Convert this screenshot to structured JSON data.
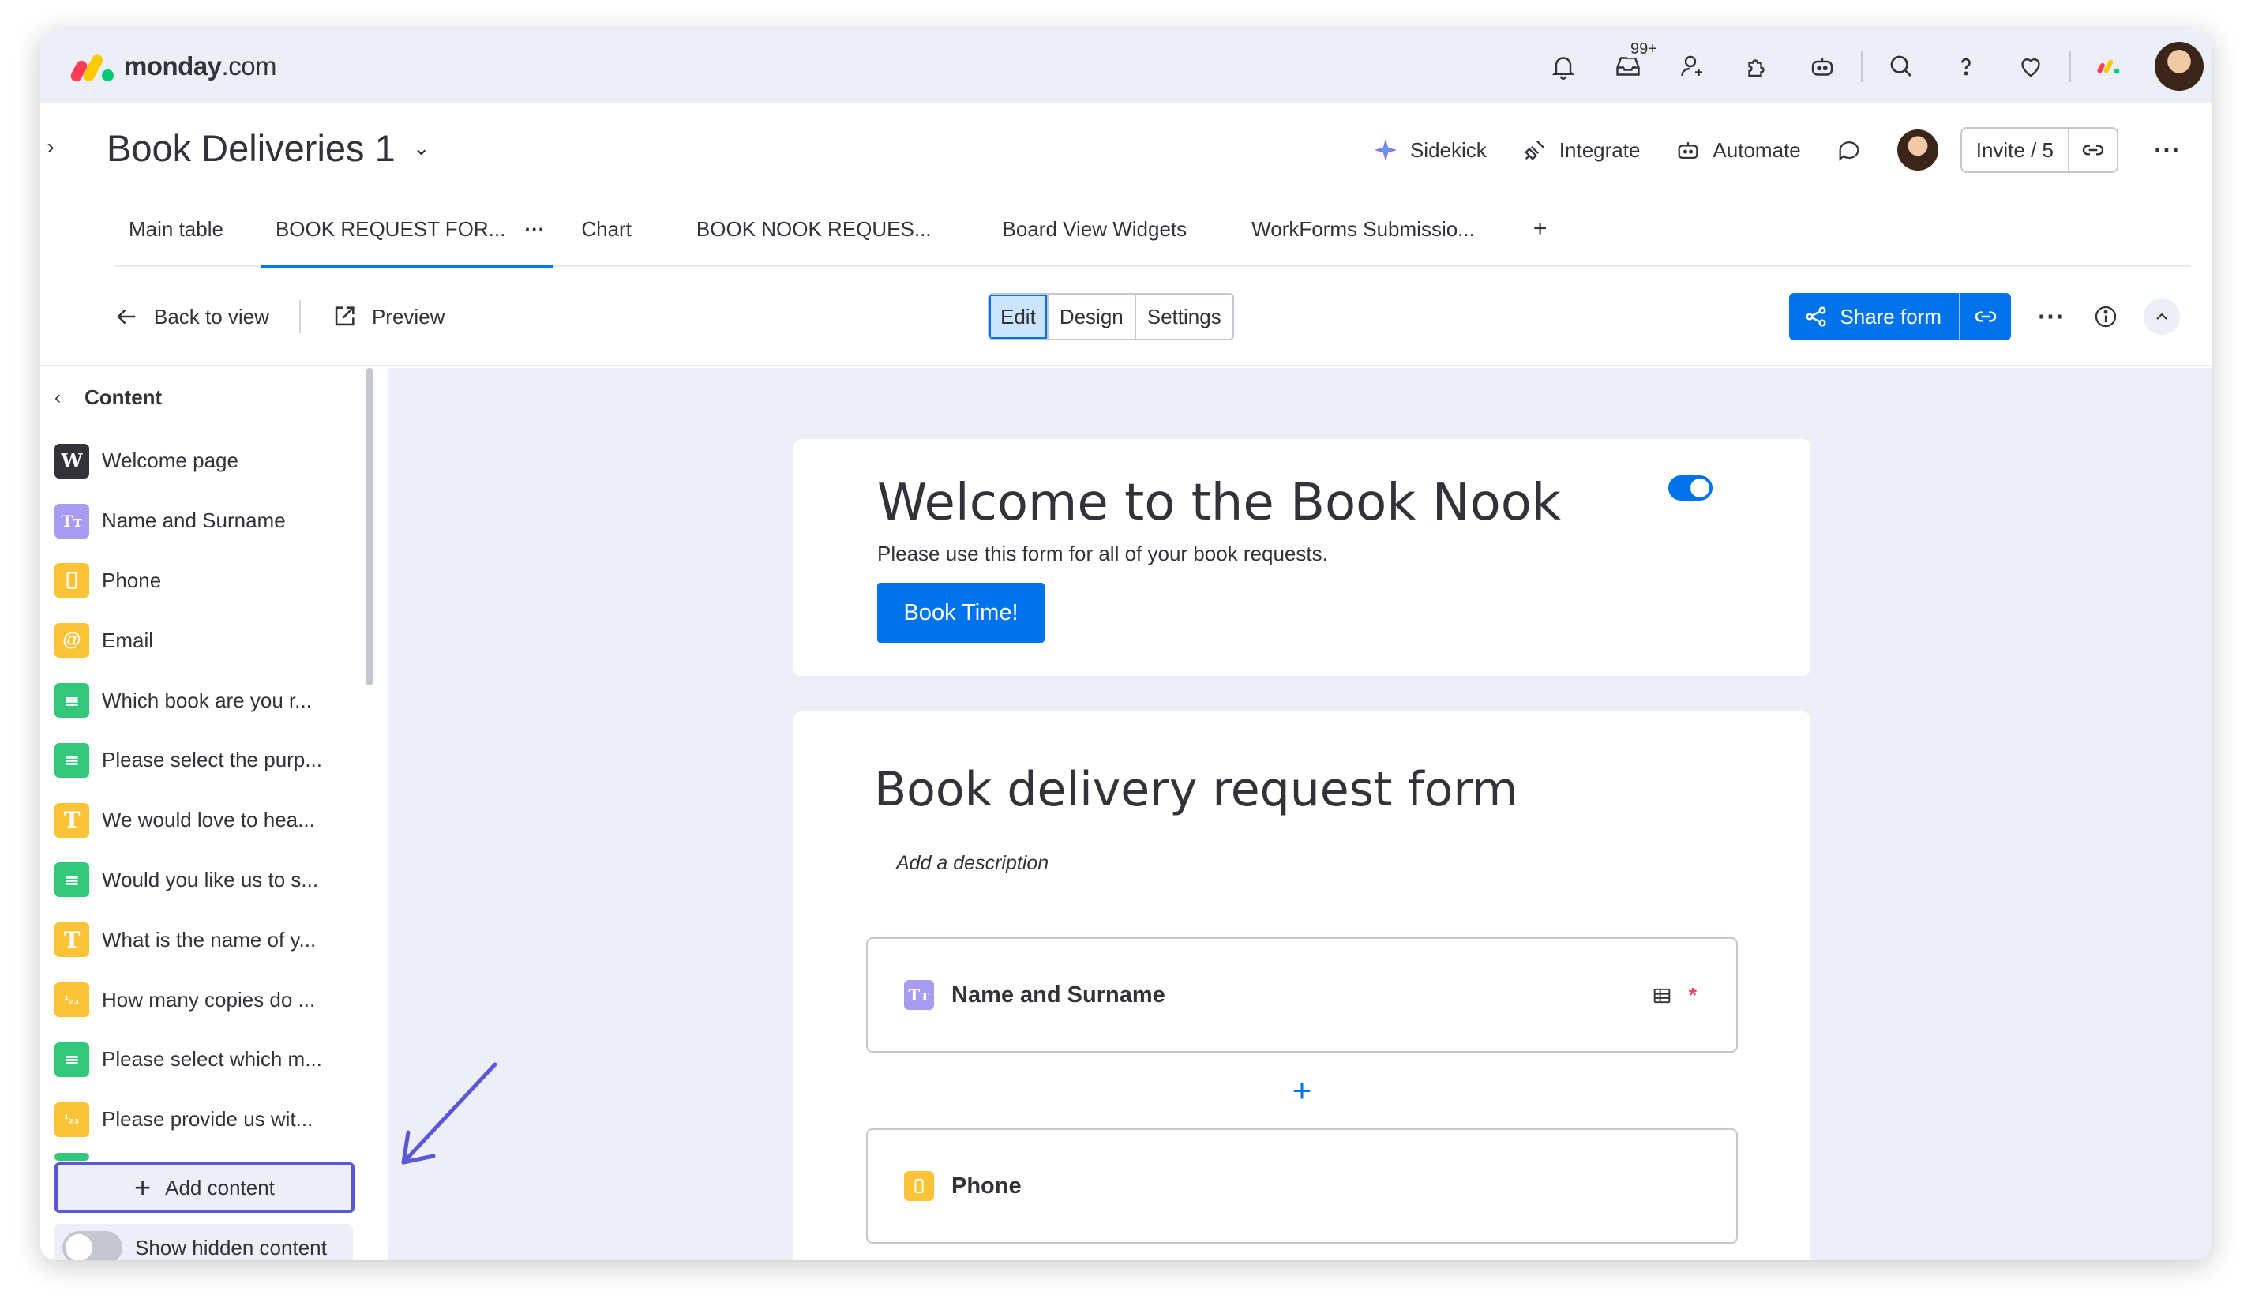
{
  "app": {
    "logo_brand": "monday",
    "logo_suffix": ".com",
    "inbox_badge": "99+",
    "icons": [
      "bell-icon",
      "inbox-icon",
      "invite-members-icon",
      "apps-icon",
      "ai-robot-icon",
      "search-icon",
      "help-icon",
      "heart-icon",
      "monday-products-icon",
      "user-avatar"
    ],
    "colors": {
      "brand_red": "#ff3d57",
      "brand_yellow": "#ffcb00",
      "brand_green": "#00ca72",
      "primary": "#0073ea",
      "annotation": "#5a57d8"
    }
  },
  "board": {
    "title": "Book Deliveries 1",
    "actions": {
      "sidekick": "Sidekick",
      "integrate": "Integrate",
      "automate": "Automate",
      "invite": "Invite / 5"
    }
  },
  "tabs": [
    {
      "label": "Main table"
    },
    {
      "label": "BOOK REQUEST FOR...",
      "active": true,
      "more": "···"
    },
    {
      "label": "Chart"
    },
    {
      "label": "BOOK NOOK REQUES..."
    },
    {
      "label": "Board View Widgets"
    },
    {
      "label": "WorkForms Submissio..."
    },
    {
      "label": "+"
    }
  ],
  "toolbar": {
    "back": "Back to view",
    "preview": "Preview",
    "modes": [
      "Edit",
      "Design",
      "Settings"
    ],
    "active_mode": "Edit",
    "share": "Share form"
  },
  "panel": {
    "title": "Content",
    "fields": [
      {
        "label": "Welcome page",
        "type": "welcome",
        "glyph": "W"
      },
      {
        "label": "Name and Surname",
        "type": "text",
        "glyph": "Tт"
      },
      {
        "label": "Phone",
        "type": "phone",
        "glyph": "▯"
      },
      {
        "label": "Email",
        "type": "email",
        "glyph": "@"
      },
      {
        "label": "Which book are you r...",
        "type": "dropdown",
        "glyph": "≡"
      },
      {
        "label": "Please select the purp...",
        "type": "dropdown",
        "glyph": "≡"
      },
      {
        "label": "We would love to hea...",
        "type": "long-text",
        "glyph": "T"
      },
      {
        "label": "Would you like us to s...",
        "type": "dropdown",
        "glyph": "≡"
      },
      {
        "label": "What is the name of y...",
        "type": "long-text",
        "glyph": "T"
      },
      {
        "label": "How many copies do ...",
        "type": "number",
        "glyph": "¹₂₃"
      },
      {
        "label": "Please select which m...",
        "type": "dropdown",
        "glyph": "≡"
      },
      {
        "label": "Please provide us wit...",
        "type": "number",
        "glyph": "¹₂₃"
      }
    ],
    "add_content": "Add content",
    "show_hidden": "Show hidden content",
    "show_hidden_on": false
  },
  "form": {
    "welcome_title": "Welcome to the Book Nook",
    "welcome_text": "Please use this form for all of your book requests.",
    "welcome_button": "Book Time!",
    "welcome_enabled": true,
    "title": "Book delivery request form",
    "description_placeholder": "Add a description",
    "questions": [
      {
        "label": "Name and Surname",
        "type": "text",
        "glyph": "Tт",
        "required": true,
        "required_mark": "*"
      },
      {
        "label": "Phone",
        "type": "phone",
        "glyph": "▯",
        "required": false
      }
    ],
    "add_question": "+"
  }
}
